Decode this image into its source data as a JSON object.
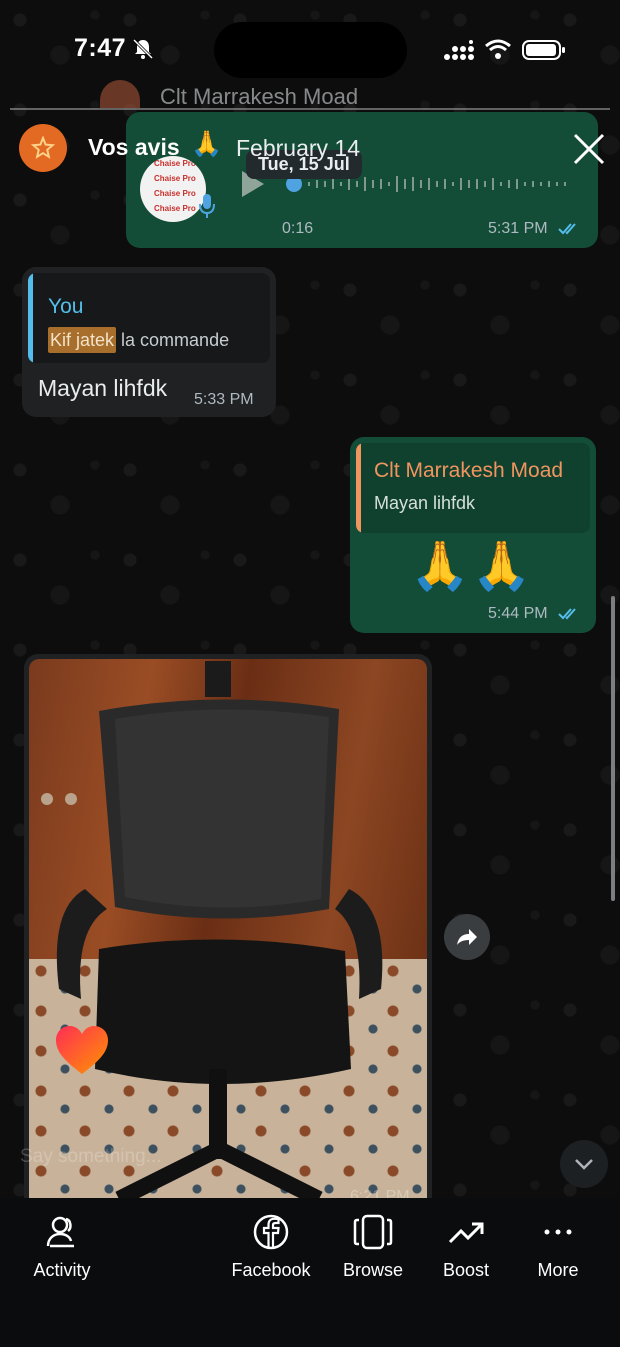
{
  "status_bar": {
    "time": "7:47"
  },
  "ghost_header": {
    "title": "Clt Marrakesh Moad"
  },
  "story": {
    "title": "Vos avis",
    "emoji": "🙏",
    "date": "February 14"
  },
  "voice_message": {
    "date_pill": "Tue, 15 Jul",
    "duration": "0:16",
    "time": "5:31 PM",
    "thumb_lines": [
      "Chaise Pro",
      "Chaise Pro",
      "Chaise Pro",
      "Chaise Pro"
    ]
  },
  "incoming_reply": {
    "quote_author": "You",
    "quote_highlight": "Kif jatek",
    "quote_rest": " la commande",
    "text": "Mayan lihfdk",
    "time": "5:33 PM"
  },
  "outgoing_reply": {
    "quote_author": "Clt Marrakesh Moad",
    "quote_text": "Mayan lihfdk",
    "emojis": "🙏🙏",
    "time": "5:44 PM"
  },
  "image_message": {
    "placeholder": "Say something...",
    "time": "6:21 PM"
  },
  "colors": {
    "outgoing": "#134d37",
    "incoming": "#1f2123",
    "accent_blue": "#53bdeb",
    "accent_orange": "#f0955f",
    "story_avatar": "#e26a22"
  },
  "bottom_nav": [
    {
      "label": "Activity",
      "icon": "activity-icon"
    },
    {
      "label": "Facebook",
      "icon": "facebook-icon"
    },
    {
      "label": "Browse",
      "icon": "browse-icon"
    },
    {
      "label": "Boost",
      "icon": "boost-icon"
    },
    {
      "label": "More",
      "icon": "more-icon"
    }
  ]
}
